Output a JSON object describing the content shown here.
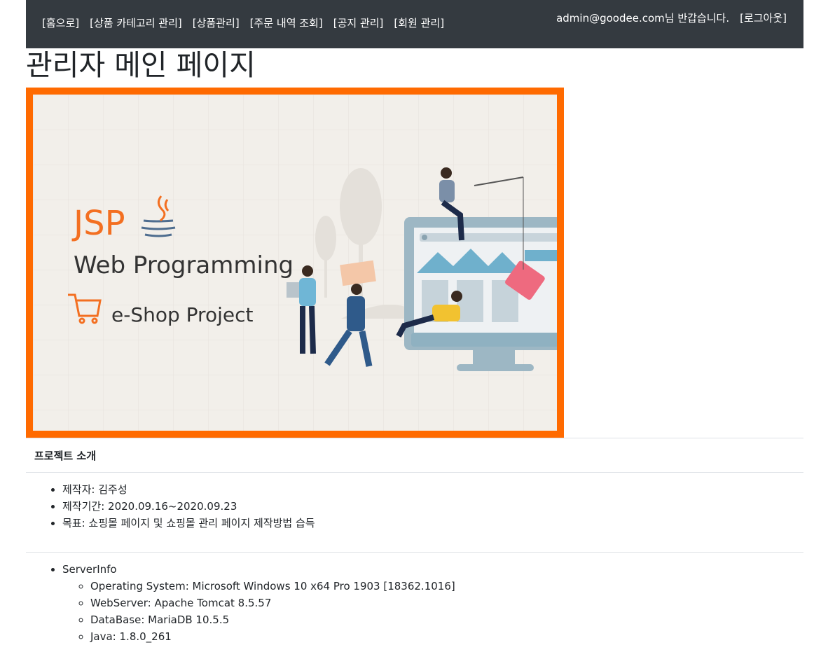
{
  "nav": {
    "links": [
      "[홈으로]",
      "[상품 카테고리 관리]",
      "[상품관리]",
      "[주문 내역 조회]",
      "[공지 관리]",
      "[회원 관리]"
    ],
    "welcome": "admin@goodee.com님 반갑습니다.",
    "logout": "[로그아웃]"
  },
  "page": {
    "title": "관리자 메인 페이지"
  },
  "banner": {
    "jsp": "JSP",
    "subtitle": "Web Programming",
    "project": "e-Shop Project",
    "frame_color": "#ff6a00",
    "accent_color": "#f36f21"
  },
  "intro": {
    "heading": "프로젝트 소개",
    "items": [
      "제작자: 김주성",
      "제작기간: 2020.09.16~2020.09.23",
      "목표: 쇼핑몰 페이지 및 쇼핑몰 관리 페이지 제작방법 습득"
    ]
  },
  "server": {
    "label": "ServerInfo",
    "items": [
      "Operating System: Microsoft Windows 10 x64 Pro 1903 [18362.1016]",
      "WebServer: Apache Tomcat 8.5.57",
      "DataBase: MariaDB 10.5.5",
      "Java: 1.8.0_261"
    ]
  }
}
